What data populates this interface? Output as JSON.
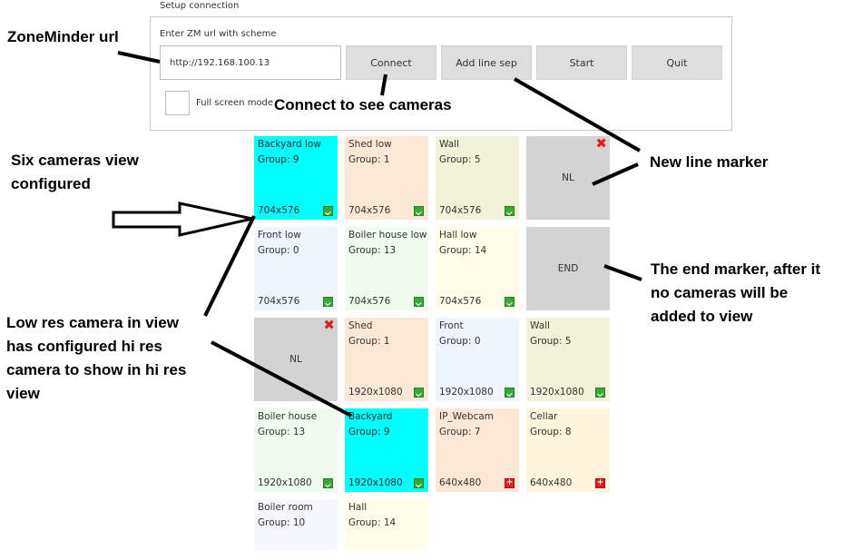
{
  "setup": {
    "legend": "Setup connection",
    "url_label": "Enter ZM url with scheme",
    "url_value": "http://192.168.100.13",
    "buttons": {
      "connect": "Connect",
      "add_line_sep": "Add line sep",
      "start": "Start",
      "quit": "Quit"
    },
    "fullscreen_label": "Full screen mode"
  },
  "tiles": {
    "backyard_low": {
      "name": "Backyard low",
      "group": "Group: 9",
      "res": "704x576",
      "color": "#00ffff"
    },
    "shed_low": {
      "name": "Shed low",
      "group": "Group: 1",
      "res": "704x576",
      "color": "#fbe8d6"
    },
    "wall_low": {
      "name": "Wall",
      "group": "Group: 5",
      "res": "704x576",
      "color": "#f2f2da"
    },
    "nl_1": {
      "label": "NL"
    },
    "front_low": {
      "name": "Front low",
      "group": "Group: 0",
      "res": "704x576",
      "color": "#eef5fd"
    },
    "boiler_house_low": {
      "name": "Boiler house low",
      "group": "Group: 13",
      "res": "704x576",
      "color": "#eefbee"
    },
    "hall_low": {
      "name": "Hall low",
      "group": "Group: 14",
      "res": "704x576",
      "color": "#fffdea"
    },
    "end": {
      "label": "END"
    },
    "nl_2": {
      "label": "NL"
    },
    "shed": {
      "name": "Shed",
      "group": "Group: 1",
      "res": "1920x1080",
      "color": "#fbe8d6"
    },
    "front": {
      "name": "Front",
      "group": "Group: 0",
      "res": "1920x1080",
      "color": "#eef5fd"
    },
    "wall": {
      "name": "Wall",
      "group": "Group: 5",
      "res": "1920x1080",
      "color": "#f2f2da"
    },
    "boiler_house": {
      "name": "Boiler house",
      "group": "Group: 13",
      "res": "1920x1080",
      "color": "#eefbee"
    },
    "backyard": {
      "name": "Backyard",
      "group": "Group: 9",
      "res": "1920x1080",
      "color": "#00ffff"
    },
    "ip_webcam": {
      "name": "IP_Webcam",
      "group": "Group: 7",
      "res": "640x480",
      "color": "#fde7d6"
    },
    "cellar": {
      "name": "Cellar",
      "group": "Group: 8",
      "res": "640x480",
      "color": "#fff5dd"
    },
    "boiler_room": {
      "name": "Boiler room",
      "group": "Group: 10",
      "color": "#f4f7fd"
    },
    "hall": {
      "name": "Hall",
      "group": "Group: 14",
      "color": "#fffdea"
    }
  },
  "marker_color": "#d3d3d3",
  "annotations": {
    "zm_url": "ZoneMinder url",
    "connect": "Connect to see cameras",
    "new_line": "New line marker",
    "six_cameras": [
      "Six cameras view",
      "configured"
    ],
    "end_marker": [
      "The end marker, after it",
      "no cameras will be",
      "added to view"
    ],
    "low_res": [
      "Low res camera in view",
      "has configured hi res",
      "camera to show in hi res",
      "view"
    ]
  }
}
